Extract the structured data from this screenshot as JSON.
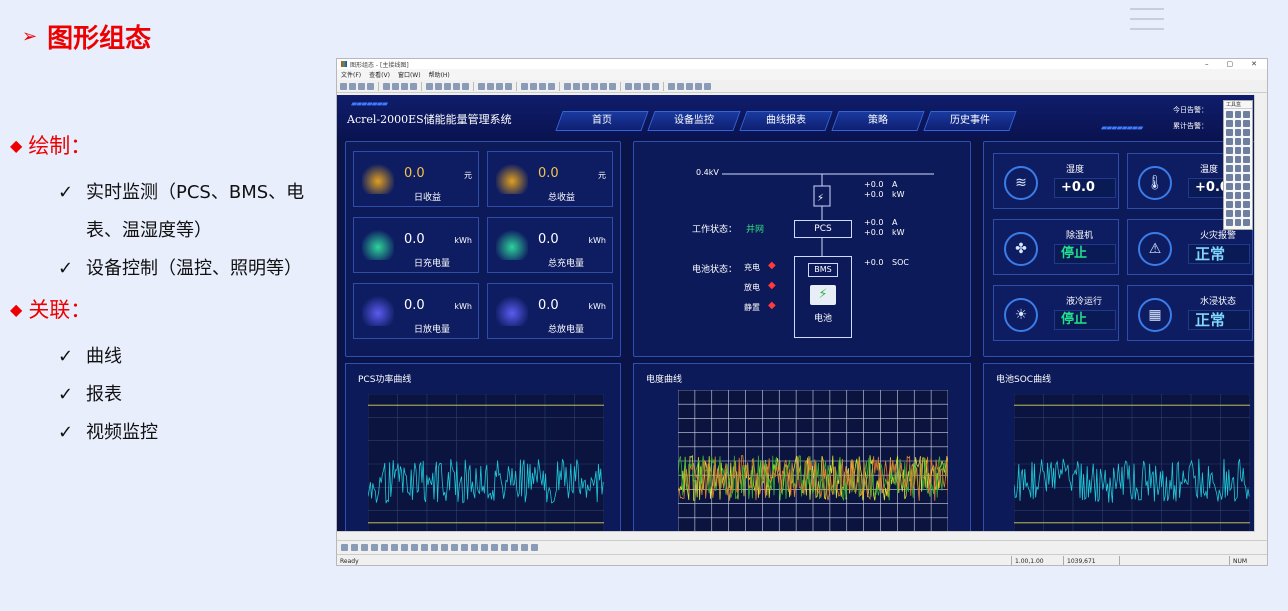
{
  "slide": {
    "title": "图形组态",
    "arrow": "➢",
    "sections": [
      {
        "heading": "绘制：",
        "items": [
          "实时监测（PCS、BMS、电表、温湿度等）",
          "设备控制（温控、照明等）"
        ]
      },
      {
        "heading": "关联：",
        "items": [
          "曲线",
          "报表",
          "视频监控"
        ]
      }
    ]
  },
  "window": {
    "title": "图形组态 - [主接线图]",
    "menus": [
      "文件(F)",
      "查看(V)",
      "窗口(W)",
      "帮助(H)"
    ],
    "controls": [
      "–",
      "▢",
      "✕"
    ],
    "status_ready": "Ready",
    "status_coord": "1.00,1.00",
    "status_size": "1039,671",
    "status_num": "NUM",
    "toolbox_title": "工具盒"
  },
  "scada": {
    "system_name": "Acrel-2000ES储能能量管理系统",
    "nav": [
      "首页",
      "设备监控",
      "曲线报表",
      "策略",
      "历史事件"
    ],
    "alarm_today": "今日告警：",
    "alarm_total": "累计告警：",
    "revenue_cards": [
      {
        "value": "0.0",
        "unit": "元",
        "label": "日收益"
      },
      {
        "value": "0.0",
        "unit": "元",
        "label": "总收益"
      },
      {
        "value": "0.0",
        "unit": "kWh",
        "label": "日充电量"
      },
      {
        "value": "0.0",
        "unit": "kWh",
        "label": "总充电量"
      },
      {
        "value": "0.0",
        "unit": "kWh",
        "label": "日放电量"
      },
      {
        "value": "0.0",
        "unit": "kWh",
        "label": "总放电量"
      }
    ],
    "diagram": {
      "voltage": "0.4kV",
      "work_status_label": "工作状态：",
      "work_status_value": "并网",
      "battery_status_label": "电池状态：",
      "charge": "充电",
      "discharge": "放电",
      "idle": "静置",
      "pcs": "PCS",
      "bms": "BMS",
      "battery": "电池",
      "r1a": "+0.0",
      "r1au": "A",
      "r1b": "+0.0",
      "r1bu": "kW",
      "r2a": "+0.0",
      "r2au": "A",
      "r2b": "+0.0",
      "r2bu": "kW",
      "soc": "+0.0",
      "socu": "SOC"
    },
    "status_cards": [
      {
        "label": "湿度",
        "value": "+0.0",
        "icon": "humidity-icon"
      },
      {
        "label": "温度",
        "value": "+0.0",
        "unit": "℃",
        "icon": "thermometer-icon"
      },
      {
        "label": "除湿机",
        "value": "停止",
        "icon": "fan-icon"
      },
      {
        "label": "火灾报警",
        "value": "正常",
        "icon": "alarm-icon"
      },
      {
        "label": "液冷运行",
        "value": "停止",
        "icon": "cooling-icon"
      },
      {
        "label": "水浸状态",
        "value": "正常",
        "icon": "water-icon"
      }
    ],
    "charts": [
      "PCS功率曲线",
      "电度曲线",
      "电池SOC曲线"
    ]
  }
}
